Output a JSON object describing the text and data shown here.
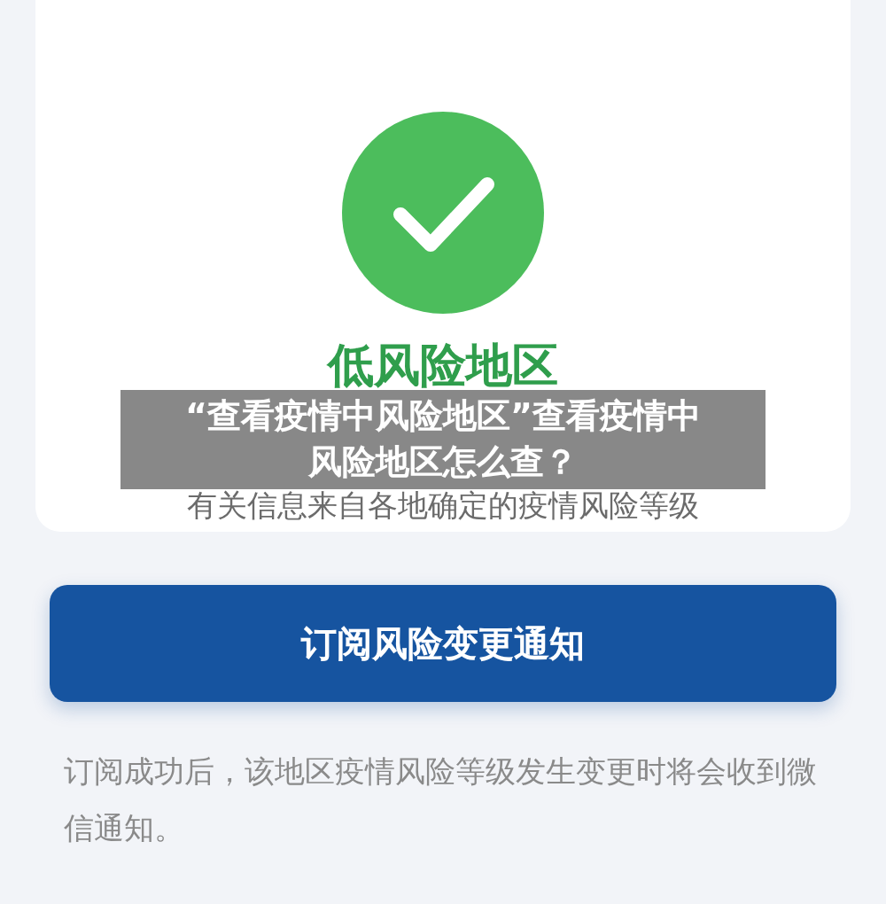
{
  "status": {
    "title": "低风险地区",
    "info": "有关信息来自各地确定的疫情风险等级"
  },
  "subscribe_button": {
    "label": "订阅风险变更通知"
  },
  "note": "订阅成功后，该地区疫情风险等级发生变更时将会收到微信通知。",
  "overlay_caption": "“查看疫情中风险地区”查看疫情中风险地区怎么查？"
}
